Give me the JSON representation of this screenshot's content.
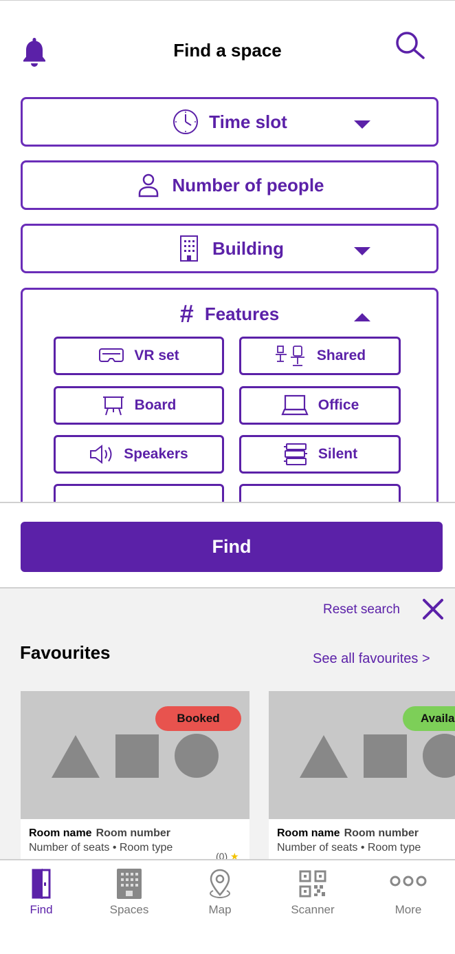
{
  "header": {
    "title": "Find a space"
  },
  "filters": {
    "time_slot": "Time slot",
    "people": "Number of people",
    "building": "Building",
    "features": "Features"
  },
  "features_chips": [
    {
      "label": "VR set",
      "icon": "vr-headset-icon"
    },
    {
      "label": "Shared",
      "icon": "shared-desk-icon"
    },
    {
      "label": "Board",
      "icon": "board-icon"
    },
    {
      "label": "Office",
      "icon": "laptop-icon"
    },
    {
      "label": "Speakers",
      "icon": "speaker-icon"
    },
    {
      "label": "Silent",
      "icon": "books-icon"
    }
  ],
  "find_button": "Find",
  "results": {
    "reset_label": "Reset search",
    "favourites_title": "Favourites",
    "see_all": "See all favourites >"
  },
  "cards": [
    {
      "badge": "Booked",
      "badge_color": "#E8534E",
      "room_name": "Room name",
      "room_number": "Room number",
      "subtitle": "Number of seats • Room type",
      "rating": "(0)"
    },
    {
      "badge": "Availa",
      "badge_color": "#7DCF58",
      "room_name": "Room name",
      "room_number": "Room number",
      "subtitle": "Number of seats • Room type"
    }
  ],
  "nav": [
    {
      "label": "Find",
      "icon": "door-icon",
      "active": true
    },
    {
      "label": "Spaces",
      "icon": "building-icon"
    },
    {
      "label": "Map",
      "icon": "map-pin-icon"
    },
    {
      "label": "Scanner",
      "icon": "qr-code-icon"
    },
    {
      "label": "More",
      "icon": "more-icon"
    }
  ],
  "colors": {
    "accent": "#5B21A8",
    "booked": "#E8534E",
    "available": "#7DCF58"
  }
}
